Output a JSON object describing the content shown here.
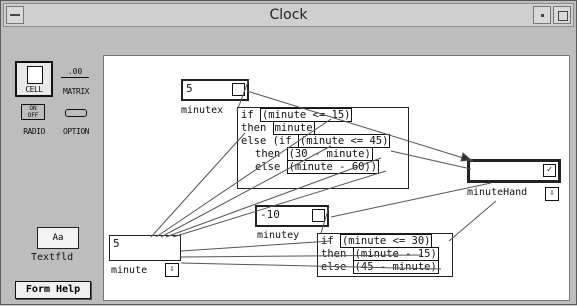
{
  "window": {
    "title": "Clock"
  },
  "palette": {
    "cell_label": "CELL",
    "matrix_label": "MATRIX",
    "matrix_icon_text": ".00",
    "radio_label": "RADIO",
    "radio_icon_text": "ON\nOFF",
    "option_label": "OPTION"
  },
  "text_tool": {
    "button_label": "Aa",
    "label": "Textfld"
  },
  "form_help": {
    "label": "Form Help"
  },
  "cells": {
    "minutex": {
      "value": "5",
      "name": "minutex"
    },
    "minutey": {
      "value": "-10",
      "name": "minutey"
    },
    "minute": {
      "value": "5",
      "name": "minute"
    },
    "minutehand": {
      "value": "",
      "name": "minuteHand",
      "check": "✓"
    }
  },
  "formula_x": {
    "line1_kw": "if ",
    "line1_ref": "(minute <= 15)",
    "line2_kw": "then ",
    "line2_ref": "minute",
    "line3_kw": "else (if ",
    "line3_ref": "(minute <= 45)",
    "line4_kw": "then ",
    "line4_ref": "(30 - minute)",
    "line5_kw": "else ",
    "line5_ref": "(minute - 60))"
  },
  "formula_y": {
    "line1_kw": "if ",
    "line1_ref": "(minute <= 30)",
    "line2_kw": "then ",
    "line2_ref": "(minute - 15)",
    "line3_kw": "else ",
    "line3_ref": "(45 - minute)"
  },
  "spinner_glyph": "⇩"
}
